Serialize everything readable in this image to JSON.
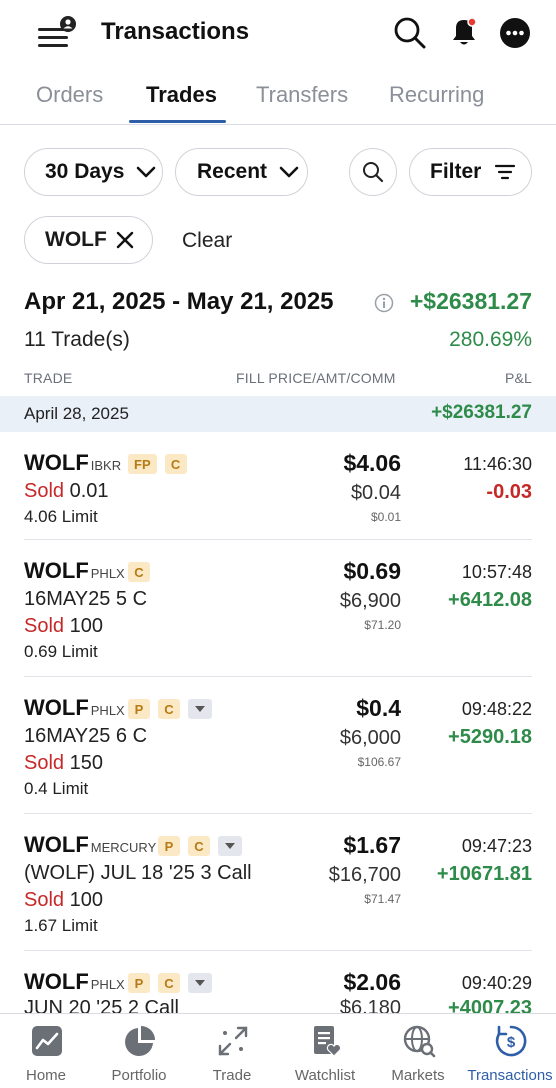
{
  "header": {
    "title": "Transactions"
  },
  "tabs": [
    {
      "label": "Orders"
    },
    {
      "label": "Trades"
    },
    {
      "label": "Transfers"
    },
    {
      "label": "Recurring"
    }
  ],
  "filters": {
    "period": "30 Days",
    "sort": "Recent",
    "filter_label": "Filter",
    "active_chip": "WOLF",
    "clear_label": "Clear"
  },
  "summary": {
    "range": "Apr 21, 2025 - May 21, 2025",
    "total_pl": "+$26381.27",
    "trade_count": "11 Trade(s)",
    "total_pct": "280.69%"
  },
  "columns": {
    "trade": "TRADE",
    "fill": "FILL PRICE/AMT/COMM",
    "pl": "P&L"
  },
  "group": {
    "date": "April 28, 2025",
    "pl": "+$26381.27"
  },
  "trades": [
    {
      "symbol": "WOLF",
      "venue": "IBKR",
      "badges": [
        "FP",
        "C"
      ],
      "dropdown": false,
      "contract": "",
      "side": "Sold",
      "qty": "0.01",
      "order": "4.06 Limit",
      "price": "$4.06",
      "amount": "$0.04",
      "comm": "$0.01",
      "time": "11:46:30",
      "pl": "-0.03",
      "pl_sign": "neg"
    },
    {
      "symbol": "WOLF",
      "venue": "PHLX",
      "badges": [
        "C"
      ],
      "dropdown": false,
      "contract": "16MAY25 5 C",
      "side": "Sold",
      "qty": "100",
      "order": "0.69 Limit",
      "price": "$0.69",
      "amount": "$6,900",
      "comm": "$71.20",
      "time": "10:57:48",
      "pl": "+6412.08",
      "pl_sign": "pos"
    },
    {
      "symbol": "WOLF",
      "venue": "PHLX",
      "badges": [
        "P",
        "C"
      ],
      "dropdown": true,
      "contract": "16MAY25 6 C",
      "side": "Sold",
      "qty": "150",
      "order": "0.4 Limit",
      "price": "$0.4",
      "amount": "$6,000",
      "comm": "$106.67",
      "time": "09:48:22",
      "pl": "+5290.18",
      "pl_sign": "pos"
    },
    {
      "symbol": "WOLF",
      "venue": "MERCURY",
      "badges": [
        "P",
        "C"
      ],
      "dropdown": true,
      "contract": "(WOLF) JUL 18 '25 3 Call",
      "side": "Sold",
      "qty": "100",
      "order": "1.67 Limit",
      "price": "$1.67",
      "amount": "$16,700",
      "comm": "$71.47",
      "time": "09:47:23",
      "pl": "+10671.81",
      "pl_sign": "pos"
    },
    {
      "symbol": "WOLF",
      "venue": "PHLX",
      "badges": [
        "P",
        "C"
      ],
      "dropdown": true,
      "contract": "JUN 20 '25 2 Call",
      "side": "",
      "qty": "",
      "order": "",
      "price": "$2.06",
      "amount": "$6,180",
      "comm": "",
      "time": "09:40:29",
      "pl": "+4007.23",
      "pl_sign": "pos"
    }
  ],
  "nav": [
    {
      "label": "Home",
      "icon": "home-chart-icon"
    },
    {
      "label": "Portfolio",
      "icon": "pie-chart-icon"
    },
    {
      "label": "Trade",
      "icon": "trade-arrows-icon"
    },
    {
      "label": "Watchlist",
      "icon": "watchlist-heart-icon"
    },
    {
      "label": "Markets",
      "icon": "globe-search-icon"
    },
    {
      "label": "Transactions",
      "icon": "dollar-cycle-icon"
    }
  ]
}
